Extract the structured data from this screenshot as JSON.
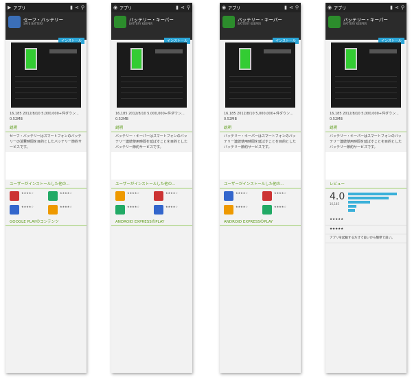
{
  "topbar": {
    "label": "アプリ"
  },
  "panels": [
    {
      "title": "セーフ・バッテリー",
      "subtitle": "SAFE BATTERY",
      "install": "インストール",
      "stats": "16,185  2012/8/10  5,000,000+件ダウン...  0.52MB",
      "section": "説明",
      "desc": "セーフ・バッテリーはスマートフォンのバッテリーの消費時間を目的としたバッテリー節約サービスです。",
      "section2": "ユーザーがインストールした他の...",
      "footer": "GOOGLE PLAYのコンテンツ"
    },
    {
      "title": "バッテリー・キーパー",
      "subtitle": "BATTERY KEEPER",
      "install": "インストール",
      "stats": "16,185  2012/8/10  5,000,000+件ダウン...  0.52MB",
      "section": "説明",
      "desc": "バッテリー・キーパーはスマートフォンのバッテリー連続使用時間を延ばすことを目的としたバッテリー節約サービスです。",
      "section2": "ユーザーがインストールした他の...",
      "footer": "ANDROID EXPRESSのPLAY"
    },
    {
      "title": "バッテリー・キーパー",
      "subtitle": "BATTERY KEEPER",
      "install": "インストール",
      "stats": "16,185  2012/8/10  5,000,000+件ダウン...  0.52MB",
      "section": "説明",
      "desc": "バッテリー・キーパーはスマートフォンのバッテリー連続使用時間を延ばすことを目的としたバッテリー節約サービスです。",
      "section2": "ユーザーがインストールした他の...",
      "footer": "ANDROID EXPRESSのPLAY"
    },
    {
      "title": "バッテリー・キーパー",
      "subtitle": "BATTERY KEEPER",
      "install": "インストール",
      "stats": "16,185  2012/8/10  5,000,000+件ダウン...  0.52MB",
      "section": "説明",
      "desc": "バッテリー・キーパーはスマートフォンのバッテリー連続使用時間を延ばすことを目的としたバッテリー節約サービスです。",
      "section2": "レビュー",
      "score": "4.0",
      "count": "16,185",
      "footer": "アプリを起動するだけで良いから簡単で良い。"
    }
  ]
}
